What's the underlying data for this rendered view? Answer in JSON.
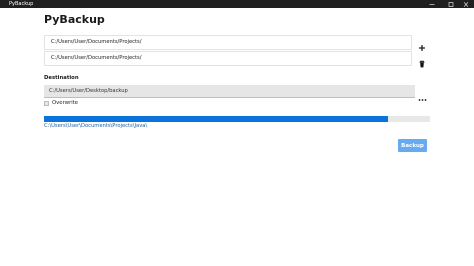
{
  "window": {
    "title": "PyBackup",
    "logo_icon": "app-logo-icon",
    "controls": [
      "minimize-icon",
      "maximize-icon",
      "close-icon"
    ]
  },
  "header": {
    "title": "PyBackup"
  },
  "sources": {
    "items": [
      "C:/Users/User/Documents/Projects/",
      "C:/Users/User/Documents/Projects/"
    ],
    "add_icon": "plus-icon",
    "remove_icon": "trash-icon"
  },
  "destination": {
    "label": "Destination",
    "value": "C:/Users/User/Desktop/backup",
    "browse_icon": "more-icon"
  },
  "overwrite": {
    "label": "Overwrite",
    "checked": false
  },
  "progress": {
    "percent": 89,
    "status": "C:\\Users\\User\\Documents\\Projects\\Java\\",
    "fill_color": "#0a74da"
  },
  "actions": {
    "backup_label": "Backup",
    "backup_color": "#66aaf0"
  }
}
